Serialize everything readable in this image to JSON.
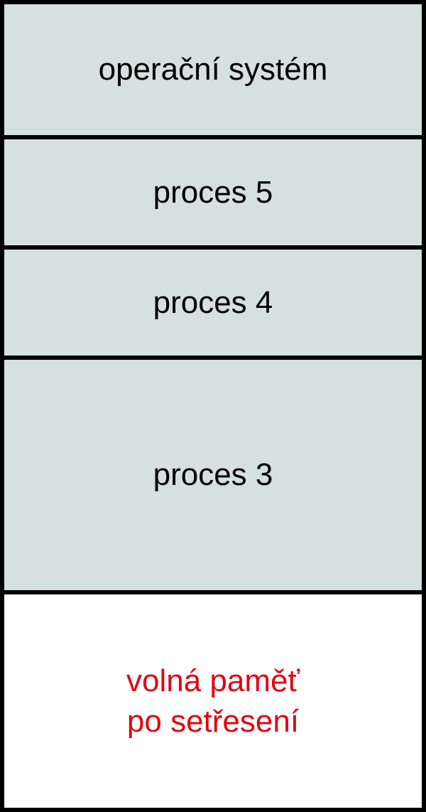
{
  "diagram": {
    "segments": [
      {
        "id": "os",
        "label": "operační systém",
        "type": "filled"
      },
      {
        "id": "p5",
        "label": "proces 5",
        "type": "filled"
      },
      {
        "id": "p4",
        "label": "proces 4",
        "type": "filled"
      },
      {
        "id": "p3",
        "label": "proces 3",
        "type": "filled"
      },
      {
        "id": "free",
        "label": "volná paměť\npo setřesení",
        "type": "empty"
      }
    ]
  }
}
